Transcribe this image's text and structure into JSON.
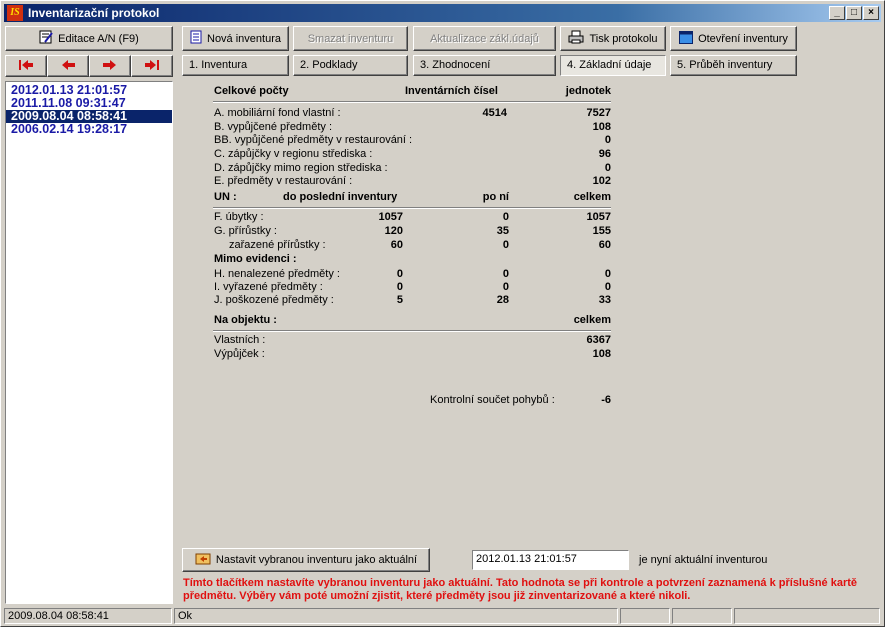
{
  "window": {
    "title": "Inventarizační protokol"
  },
  "toolbar": {
    "edit_label": "Editace A/N (F9)",
    "new_label": "Nová inventura",
    "delete_label": "Smazat inventuru",
    "update_label": "Aktualizace zákl.údajů",
    "print_label": "Tisk protokolu",
    "open_label": "Otevření inventury"
  },
  "tabs": [
    "1. Inventura",
    "2. Podklady",
    "3. Zhodnocení",
    "4. Základní údaje",
    "5. Průběh inventury"
  ],
  "inventories": [
    "2012.01.13 21:01:57",
    "2011.11.08 09:31:47",
    "2009.08.04 08:58:41",
    "2006.02.14 19:28:17"
  ],
  "summary": {
    "header": {
      "label": "Celkové počty",
      "col1": "Inventárních čísel",
      "col2": "jednotek"
    },
    "rows": [
      {
        "label": "A. mobiliární fond vlastní :",
        "v1": "4514",
        "v2": "7527"
      },
      {
        "label": "B. vypůjčené předměty :",
        "v1": "",
        "v2": "108"
      },
      {
        "label": "BB. vypůjčené předměty v restaurování :",
        "v1": "",
        "v2": "0"
      },
      {
        "label": "C. zápůjčky v regionu střediska :",
        "v1": "",
        "v2": "96"
      },
      {
        "label": "D. zápůjčky mimo region střediska :",
        "v1": "",
        "v2": "0"
      },
      {
        "label": "E. předměty v restaurování :",
        "v1": "",
        "v2": "102"
      }
    ]
  },
  "movements": {
    "header": {
      "label": "UN :",
      "col1": "do poslední inventury",
      "col2": "po ní",
      "col3": "celkem"
    },
    "rows": [
      {
        "label": "F. úbytky :",
        "v1": "1057",
        "v2": "0",
        "v3": "1057"
      },
      {
        "label": "G. přírůstky :",
        "v1": "120",
        "v2": "35",
        "v3": "155"
      },
      {
        "label": "zařazené přírůstky :",
        "v1": "60",
        "v2": "0",
        "v3": "60"
      }
    ],
    "outside_label": "Mimo evidenci :",
    "outside_rows": [
      {
        "label": "H. nenalezené předměty :",
        "v1": "0",
        "v2": "0",
        "v3": "0"
      },
      {
        "label": "I. vyřazené předměty :",
        "v1": "0",
        "v2": "0",
        "v3": "0"
      },
      {
        "label": "J. poškozené předměty :",
        "v1": "5",
        "v2": "28",
        "v3": "33"
      }
    ]
  },
  "object": {
    "header": {
      "label": "Na objektu :",
      "col": "celkem"
    },
    "rows": [
      {
        "label": "Vlastních :",
        "v": "6367"
      },
      {
        "label": "Výpůjček :",
        "v": "108"
      }
    ]
  },
  "checksum": {
    "label": "Kontrolní součet pohybů :",
    "value": "-6"
  },
  "set_current": {
    "button_label": "Nastavit vybranou inventuru jako aktuální",
    "current_value": "2012.01.13 21:01:57",
    "suffix": "je nyní aktuální inventurou",
    "hint": "Tímto tlačítkem nastavíte vybranou inventuru jako aktuální. Tato hodnota se při kontrole a potvrzení zaznamená k příslušné kartě předmětu. Výběry vám poté umožní zjistit, které předměty jsou již zinventarizované a které nikoli."
  },
  "statusbar": {
    "selected": "2009.08.04 08:58:41",
    "status": "Ok"
  }
}
